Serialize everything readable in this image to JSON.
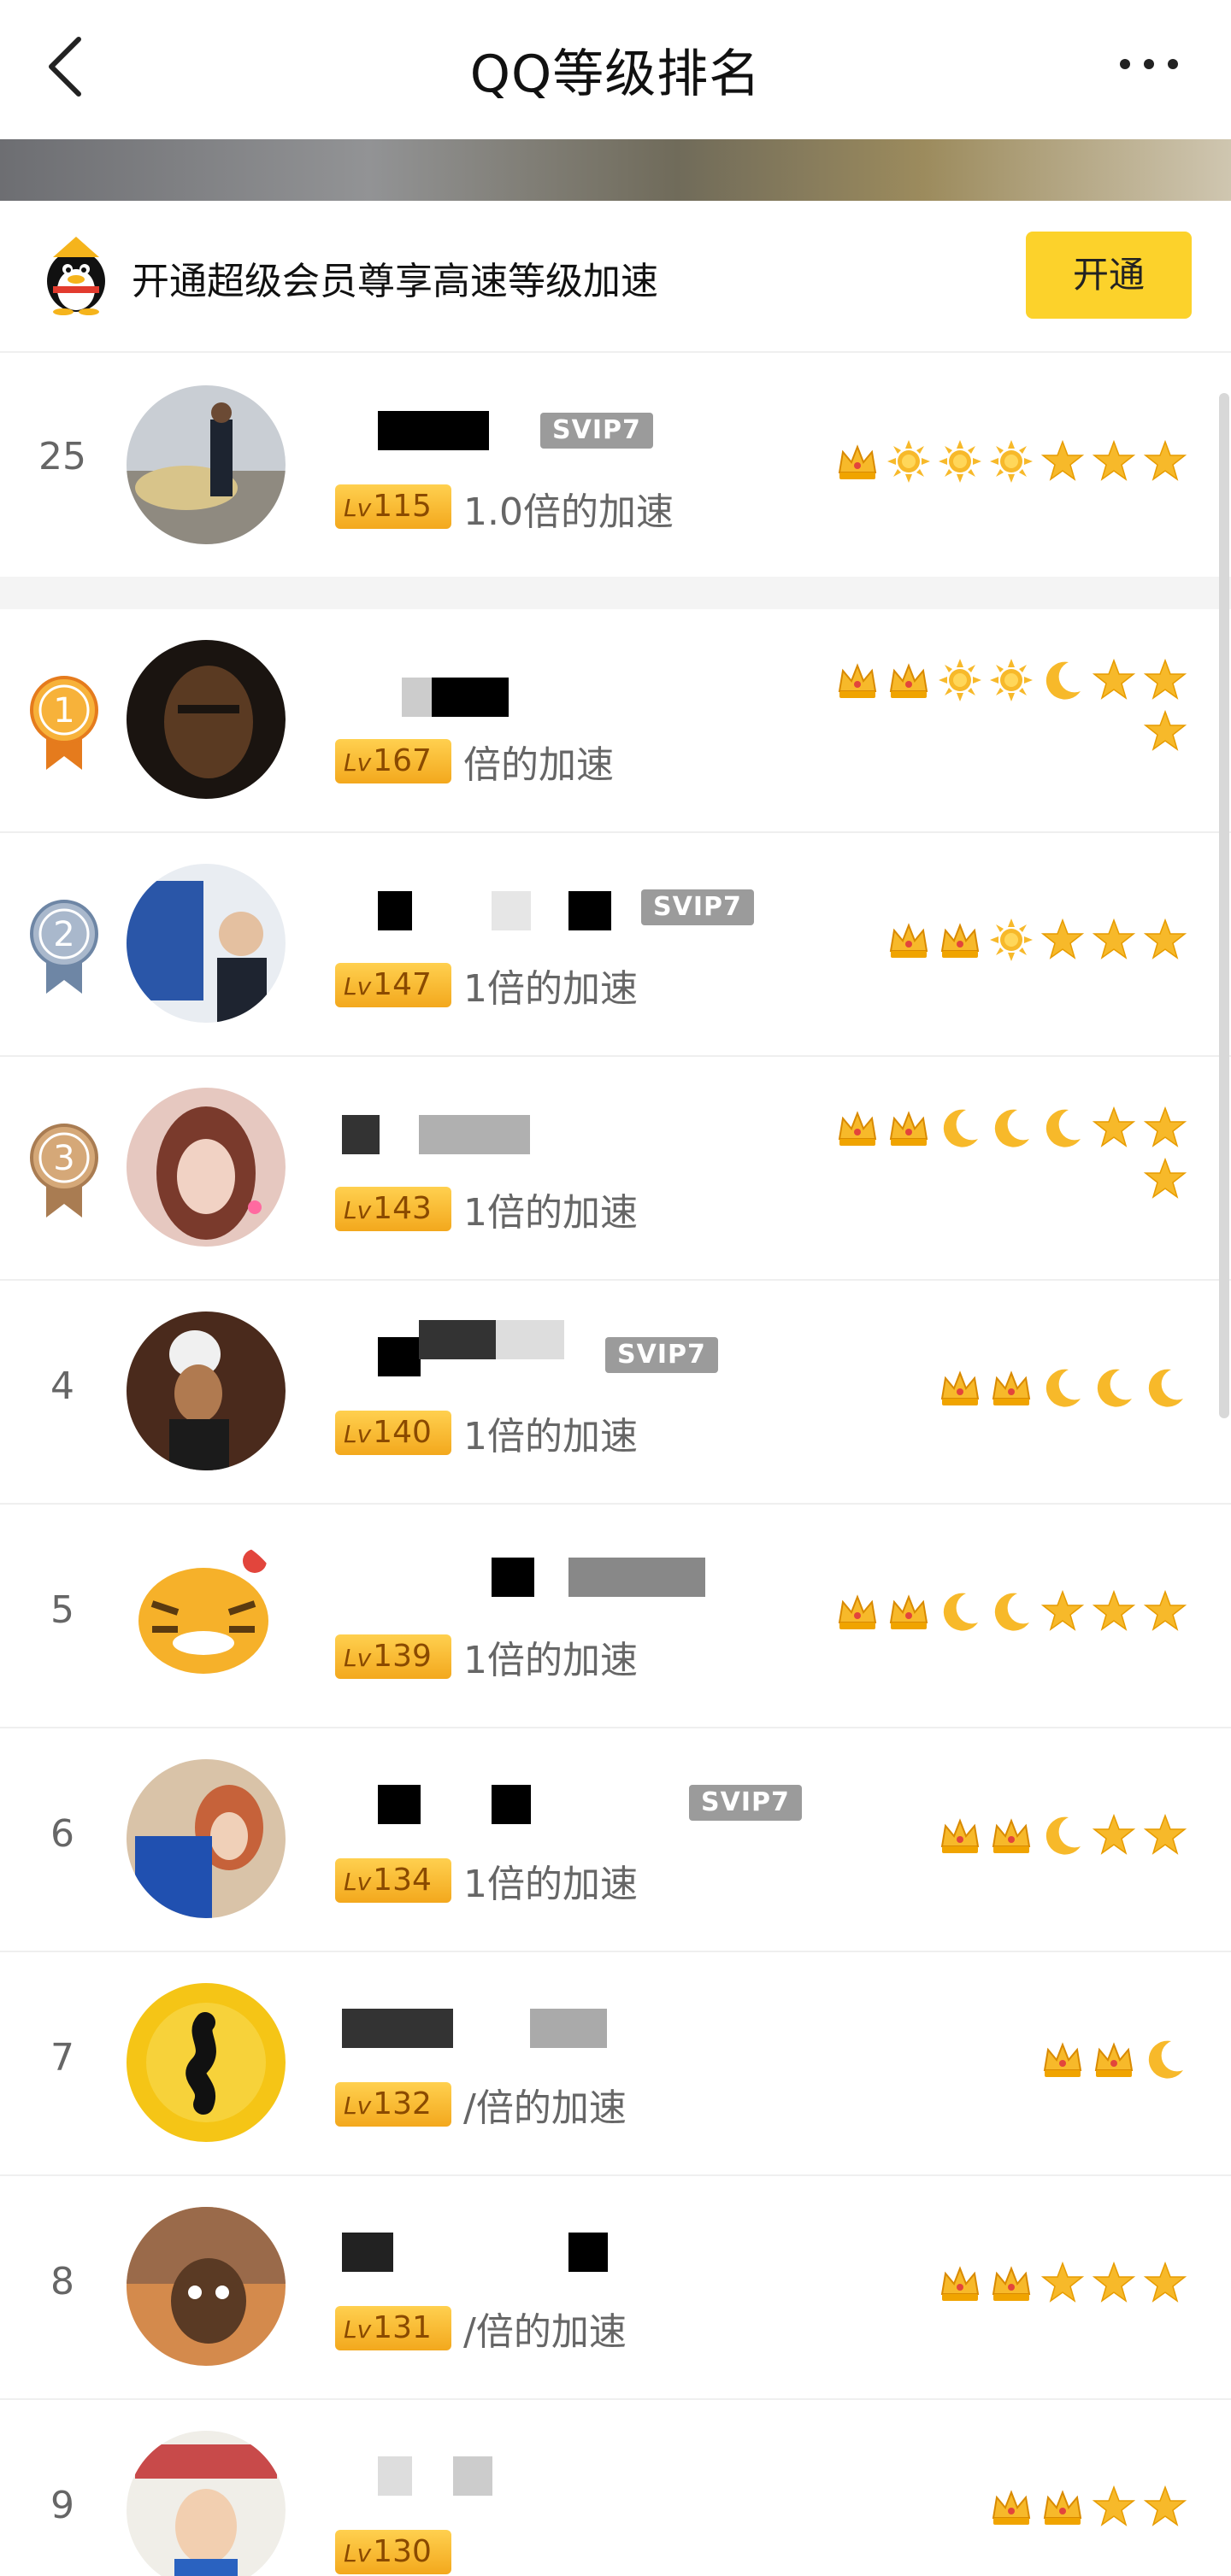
{
  "header": {
    "title": "QQ等级排名",
    "back_icon": "chevron-left-icon",
    "more_icon": "more-dots-icon"
  },
  "promo": {
    "text": "开通超级会员尊享高速等级加速",
    "button_label": "开通",
    "icon": "qq-penguin-icon",
    "accent": "#fcd22b"
  },
  "my_rank": {
    "rank": "25",
    "badge": "SVIP7",
    "level": "115",
    "speed": "1.0倍的加速",
    "icons": [
      "crown",
      "sun",
      "sun",
      "sun",
      "star",
      "star",
      "star"
    ]
  },
  "rows": [
    {
      "rank": "1",
      "medal": "gold",
      "badge": "",
      "level": "167",
      "speed": "倍的加速",
      "icons": [
        "crown",
        "crown",
        "sun",
        "sun",
        "moon",
        "star",
        "star",
        "star"
      ]
    },
    {
      "rank": "2",
      "medal": "silver",
      "badge": "SVIP7",
      "level": "147",
      "speed": "1倍的加速",
      "icons": [
        "crown",
        "crown",
        "sun",
        "star",
        "star",
        "star"
      ]
    },
    {
      "rank": "3",
      "medal": "bronze",
      "badge": "",
      "level": "143",
      "speed": "1倍的加速",
      "icons": [
        "crown",
        "crown",
        "moon",
        "moon",
        "moon",
        "star",
        "star",
        "star"
      ]
    },
    {
      "rank": "4",
      "medal": "",
      "badge": "SVIP7",
      "level": "140",
      "speed": "1倍的加速",
      "icons": [
        "crown",
        "crown",
        "moon",
        "moon",
        "moon"
      ]
    },
    {
      "rank": "5",
      "medal": "",
      "badge": "",
      "level": "139",
      "speed": "1倍的加速",
      "icons": [
        "crown",
        "crown",
        "moon",
        "moon",
        "star",
        "star",
        "star"
      ]
    },
    {
      "rank": "6",
      "medal": "",
      "badge": "SVIP7",
      "level": "134",
      "speed": "1倍的加速",
      "icons": [
        "crown",
        "crown",
        "moon",
        "star",
        "star"
      ]
    },
    {
      "rank": "7",
      "medal": "",
      "badge": "",
      "level": "132",
      "speed": "/倍的加速",
      "icons": [
        "crown",
        "crown",
        "moon"
      ]
    },
    {
      "rank": "8",
      "medal": "",
      "badge": "",
      "level": "131",
      "speed": "/倍的加速",
      "icons": [
        "crown",
        "crown",
        "star",
        "star",
        "star"
      ]
    },
    {
      "rank": "9",
      "medal": "",
      "badge": "",
      "level": "130",
      "speed": "",
      "icons": [
        "crown",
        "crown",
        "star",
        "star"
      ]
    }
  ],
  "level_prefix": "Lv",
  "colors": {
    "level_badge": "#f3a81d",
    "svip_badge": "#9b9b9b",
    "icon_gold": "#f7b92a"
  }
}
